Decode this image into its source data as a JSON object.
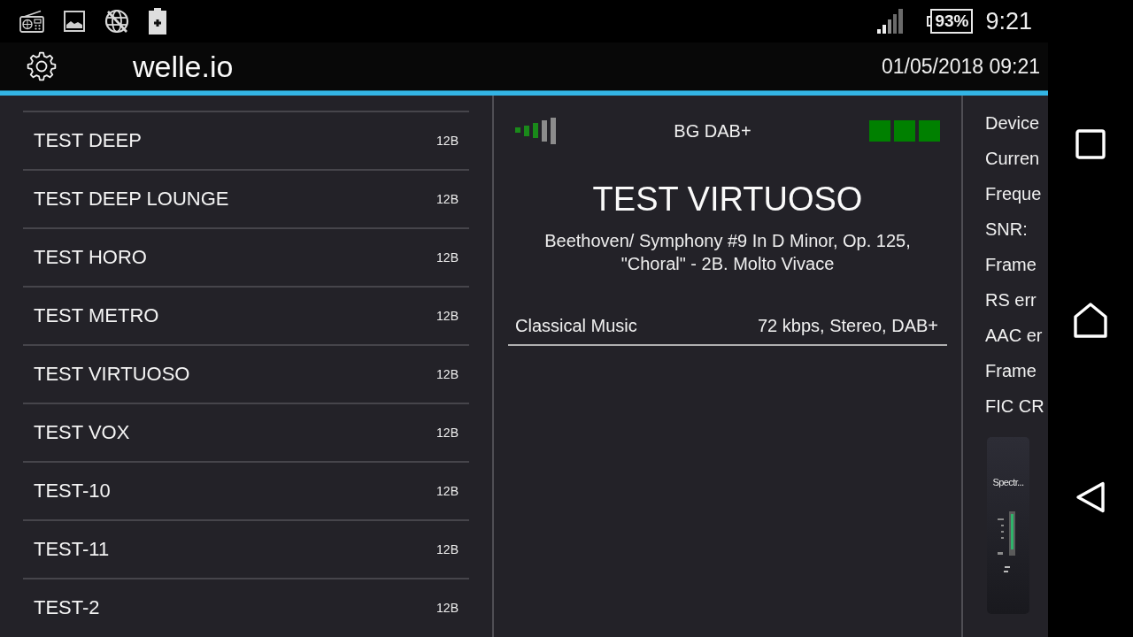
{
  "status_bar": {
    "battery": "93%",
    "time": "9:21"
  },
  "toolbar": {
    "title": "welle.io",
    "datetime": "01/05/2018 09:21"
  },
  "stations": [
    {
      "name": "TEST DEEP",
      "channel": "12B"
    },
    {
      "name": "TEST DEEP LOUNGE",
      "channel": "12B"
    },
    {
      "name": "TEST HORO",
      "channel": "12B"
    },
    {
      "name": "TEST METRO",
      "channel": "12B"
    },
    {
      "name": "TEST VIRTUOSO",
      "channel": "12B"
    },
    {
      "name": "TEST VOX",
      "channel": "12B"
    },
    {
      "name": "TEST-10",
      "channel": "12B"
    },
    {
      "name": "TEST-11",
      "channel": "12B"
    },
    {
      "name": "TEST-2",
      "channel": "12B"
    }
  ],
  "now_playing": {
    "ensemble": "BG DAB+",
    "status_lights": [
      {
        "on": true
      },
      {
        "on": true
      },
      {
        "on": true
      }
    ],
    "station": "TEST VIRTUOSO",
    "text": "Beethoven/ Symphony #9 In D Minor, Op. 125, \"Choral\" - 2B. Molto Vivace",
    "genre": "Classical Music",
    "format": "72 kbps, Stereo, DAB+"
  },
  "info_panel": {
    "lines": [
      "Device",
      "Curren",
      "Freque",
      "SNR:",
      "Frame",
      "RS err",
      "AAC er",
      "Frame",
      "FIC CR"
    ]
  },
  "spectrum_thumbnail": {
    "label": "Spectr..."
  }
}
